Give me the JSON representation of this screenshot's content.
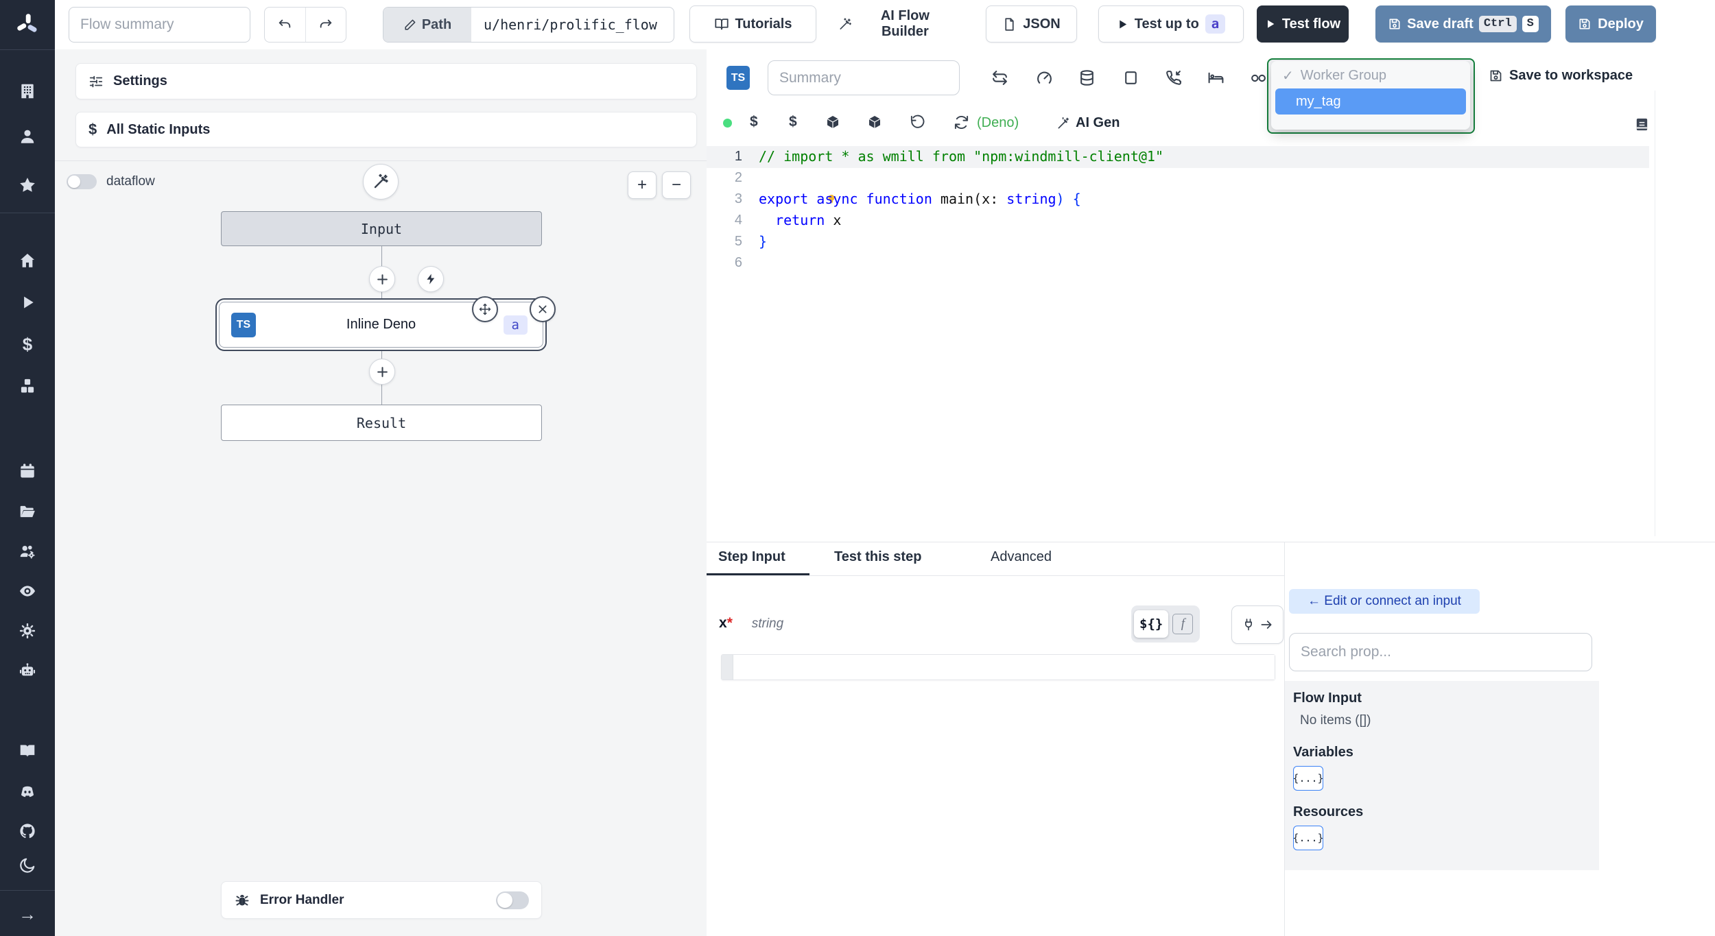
{
  "topbar": {
    "flow_summary_placeholder": "Flow summary",
    "path_label": "Path",
    "path_value": "u/henri/prolific_flow",
    "tutorials_label": "Tutorials",
    "ai_flow_builder_label": "AI Flow Builder",
    "json_label": "JSON",
    "test_up_to_label": "Test up to",
    "test_up_to_badge": "a",
    "test_flow_label": "Test flow",
    "save_draft_label": "Save draft",
    "kbd_ctrl": "Ctrl",
    "kbd_s": "S",
    "deploy_label": "Deploy"
  },
  "sidebar": {
    "icons": [
      "windmill-logo",
      "building",
      "user",
      "star",
      "home",
      "play",
      "dollar",
      "cubes",
      "calendar",
      "folder",
      "user-group-gear",
      "eye",
      "gear",
      "robot",
      "book-open",
      "discord",
      "github",
      "moon",
      "arrow-right"
    ],
    "dollar_glyph": "$",
    "arrow_glyph": "→"
  },
  "flow_panel": {
    "settings_label": "Settings",
    "all_static_inputs_label": "All Static Inputs",
    "dataflow_label": "dataflow",
    "zoom_in": "+",
    "zoom_out": "−",
    "input_node": "Input",
    "step_node": "Inline Deno",
    "step_lang_badge": "TS",
    "step_id_badge": "a",
    "result_node": "Result",
    "error_handler_label": "Error Handler"
  },
  "editor": {
    "lang_badge": "TS",
    "summary_placeholder": "Summary",
    "runtime_label": "(Deno)",
    "ai_gen_label": "AI Gen",
    "save_to_workspace_label": "Save to workspace",
    "worker_group": {
      "check": "✓",
      "label": "Worker Group",
      "selected_tag": "my_tag"
    },
    "code": {
      "line_numbers": [
        "1",
        "2",
        "3",
        "4",
        "5",
        "6"
      ],
      "l1": "// import * as wmill from \"npm:windmill-client@1\"",
      "l3_tokens": [
        "export",
        " async",
        " function",
        " main",
        "(",
        "x",
        ": ",
        "string",
        ") {"
      ],
      "l4_tokens": [
        "  return",
        " x"
      ],
      "l5": "}"
    }
  },
  "step_panel": {
    "tabs": [
      "Step Input",
      "Test this step",
      "Advanced"
    ],
    "field_name": "x",
    "required_mark": "*",
    "field_type": "string",
    "expr_toggle_label": "${}",
    "fn_toggle_label": "f"
  },
  "props_panel": {
    "edit_connect_label": "← Edit or connect an input",
    "search_placeholder": "Search prop...",
    "flow_input_title": "Flow Input",
    "no_items_label": "No items ([])",
    "variables_title": "Variables",
    "variables_badge": "{...}",
    "resources_title": "Resources",
    "resources_badge": "{...}"
  },
  "colors": {
    "sidebar_bg": "#222937",
    "slate_button": "#5f83ab",
    "dark_button": "#262e3a",
    "ts_badge": "#2f74c0",
    "selected_tag_bg": "#5a9bf5",
    "dropdown_border_green": "#15803d",
    "comment_green": "#008000",
    "keyword_blue": "#0000ff",
    "run_dot_green": "#4ade80",
    "deno_green": "#3fae52",
    "edit_connect_bg": "#dbeafe",
    "edit_connect_text": "#1e40af"
  }
}
